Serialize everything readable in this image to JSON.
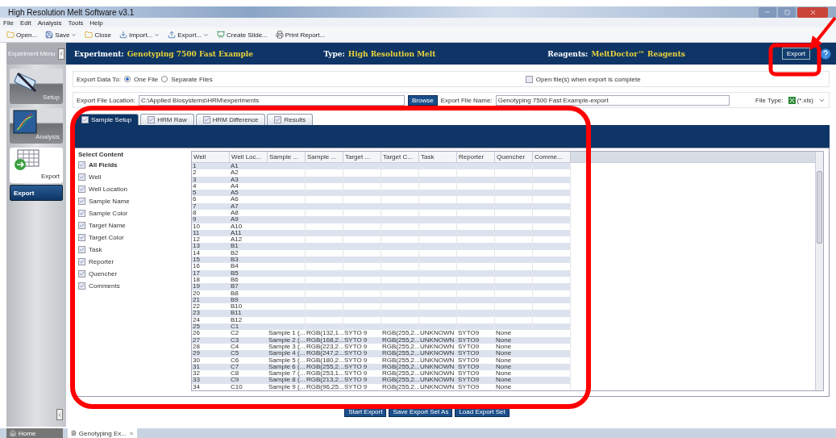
{
  "window": {
    "title": "High Resolution Melt Software v3.1"
  },
  "menu": [
    "File",
    "Edit",
    "Analysis",
    "Tools",
    "Help"
  ],
  "toolbar": [
    {
      "label": "Open...",
      "kind": "open",
      "dropdown": false
    },
    {
      "label": "Save",
      "kind": "save",
      "dropdown": true
    },
    {
      "label": "Close",
      "kind": "open",
      "dropdown": false
    },
    {
      "label": "Import...",
      "kind": "import",
      "dropdown": true
    },
    {
      "label": "Export...",
      "kind": "export",
      "dropdown": true
    },
    {
      "label": "Create Slide...",
      "kind": "slide",
      "dropdown": false
    },
    {
      "label": "Print Report...",
      "kind": "print",
      "dropdown": false
    }
  ],
  "header": {
    "fields": [
      {
        "label": "Experiment:",
        "value": "Genotyping 7500 Fast Example"
      },
      {
        "label": "Type:",
        "value": "High Resolution Melt"
      },
      {
        "label": "Reagents:",
        "value": "MeltDoctor™ Reagents"
      }
    ],
    "button": "Export"
  },
  "sidebar": {
    "title": "Experiment Menu",
    "items": [
      {
        "label": "Setup",
        "kind": "setup",
        "selected": false
      },
      {
        "label": "Analysis",
        "kind": "analysis",
        "selected": false
      },
      {
        "label": "Export",
        "kind": "export",
        "selected": true
      }
    ],
    "sub_items": [
      {
        "label": "Export",
        "selected": true
      }
    ]
  },
  "export_options": {
    "export_to_label": "Export Data To:",
    "targets": [
      {
        "label": "One File",
        "selected": true
      },
      {
        "label": "Separate Files",
        "selected": false
      }
    ],
    "open_when_complete": {
      "label": "Open file(s) when export is complete",
      "checked": false
    },
    "location_label": "Export File Location:",
    "location": "C:\\Applied Biosystems\\HRM\\experiments",
    "browse": "Browse",
    "file_name_label": "Export File Name:",
    "file_name": "Genotyping 7500 Fast Example-export",
    "file_type_label": "File Type:",
    "file_type": "(*.xls)"
  },
  "tabs": [
    {
      "label": "Sample Setup",
      "selected": true,
      "checked": true
    },
    {
      "label": "HRM Raw",
      "selected": false,
      "checked": true
    },
    {
      "label": "HRM Difference",
      "selected": false,
      "checked": true
    },
    {
      "label": "Results",
      "selected": false,
      "checked": true
    }
  ],
  "content": {
    "title": "Select Content",
    "fields": [
      {
        "label": "All Fields",
        "kind": "all",
        "checked": true
      },
      {
        "label": "Well",
        "kind": "field",
        "checked": true
      },
      {
        "label": "Well Location",
        "kind": "field",
        "checked": true
      },
      {
        "label": "Sample Name",
        "kind": "field",
        "checked": true
      },
      {
        "label": "Sample Color",
        "kind": "field",
        "checked": true
      },
      {
        "label": "Target Name",
        "kind": "field",
        "checked": true
      },
      {
        "label": "Target Color",
        "kind": "field",
        "checked": true
      },
      {
        "label": "Task",
        "kind": "field",
        "checked": true
      },
      {
        "label": "Reporter",
        "kind": "field",
        "checked": true
      },
      {
        "label": "Quencher",
        "kind": "field",
        "checked": true
      },
      {
        "label": "Comments",
        "kind": "field",
        "checked": true
      }
    ]
  },
  "table": {
    "columns": [
      "Well",
      "Well Loc...",
      "Sample ...",
      "Sample ...",
      "Target ...",
      "Target C...",
      "Task",
      "Reporter",
      "Quencher",
      "Comme..."
    ],
    "rows": [
      [
        "1",
        "A1"
      ],
      [
        "2",
        "A2"
      ],
      [
        "3",
        "A3"
      ],
      [
        "4",
        "A4"
      ],
      [
        "5",
        "A5"
      ],
      [
        "6",
        "A6"
      ],
      [
        "7",
        "A7"
      ],
      [
        "8",
        "A8"
      ],
      [
        "9",
        "A9"
      ],
      [
        "10",
        "A10"
      ],
      [
        "11",
        "A11"
      ],
      [
        "12",
        "A12"
      ],
      [
        "13",
        "B1"
      ],
      [
        "14",
        "B2"
      ],
      [
        "15",
        "B3"
      ],
      [
        "16",
        "B4"
      ],
      [
        "17",
        "B5"
      ],
      [
        "18",
        "B6"
      ],
      [
        "19",
        "B7"
      ],
      [
        "20",
        "B8"
      ],
      [
        "21",
        "B9"
      ],
      [
        "22",
        "B10"
      ],
      [
        "23",
        "B11"
      ],
      [
        "24",
        "B12"
      ],
      [
        "25",
        "C1"
      ],
      [
        "26",
        "C2",
        "Sample 1 (...",
        "RGB(132,1...",
        "SYTO 9",
        "RGB(255,2...",
        "UNKNOWN",
        "SYTO9",
        "None"
      ],
      [
        "27",
        "C3",
        "Sample 2 (...",
        "RGB(168,2...",
        "SYTO 9",
        "RGB(255,2...",
        "UNKNOWN",
        "SYTO9",
        "None"
      ],
      [
        "28",
        "C4",
        "Sample 3 (...",
        "RGB(223,2...",
        "SYTO 9",
        "RGB(255,2...",
        "UNKNOWN",
        "SYTO9",
        "None"
      ],
      [
        "29",
        "C5",
        "Sample 4 (...",
        "RGB(247,2...",
        "SYTO 9",
        "RGB(255,2...",
        "UNKNOWN",
        "SYTO9",
        "None"
      ],
      [
        "30",
        "C6",
        "Sample 5 (...",
        "RGB(180,2...",
        "SYTO 9",
        "RGB(255,2...",
        "UNKNOWN",
        "SYTO9",
        "None"
      ],
      [
        "31",
        "C7",
        "Sample 6 (...",
        "RGB(255,2...",
        "SYTO 9",
        "RGB(255,2...",
        "UNKNOWN",
        "SYTO9",
        "None"
      ],
      [
        "32",
        "C8",
        "Sample 7 (...",
        "RGB(253,1...",
        "SYTO 9",
        "RGB(255,2...",
        "UNKNOWN",
        "SYTO9",
        "None"
      ],
      [
        "33",
        "C9",
        "Sample 8 (...",
        "RGB(213,2...",
        "SYTO 9",
        "RGB(255,2...",
        "UNKNOWN",
        "SYTO9",
        "None"
      ],
      [
        "34",
        "C10",
        "Sample 9 (...",
        "RGB(96,25...",
        "SYTO 9",
        "RGB(255,2...",
        "UNKNOWN",
        "SYTO9",
        "None"
      ]
    ]
  },
  "actions": [
    "Start Export",
    "Save Export Set As",
    "Load Export Set"
  ],
  "taskbar": [
    {
      "label": "Home",
      "kind": "home",
      "selected": false
    },
    {
      "label": "Genotyping Ex...",
      "kind": "document",
      "selected": true
    }
  ]
}
